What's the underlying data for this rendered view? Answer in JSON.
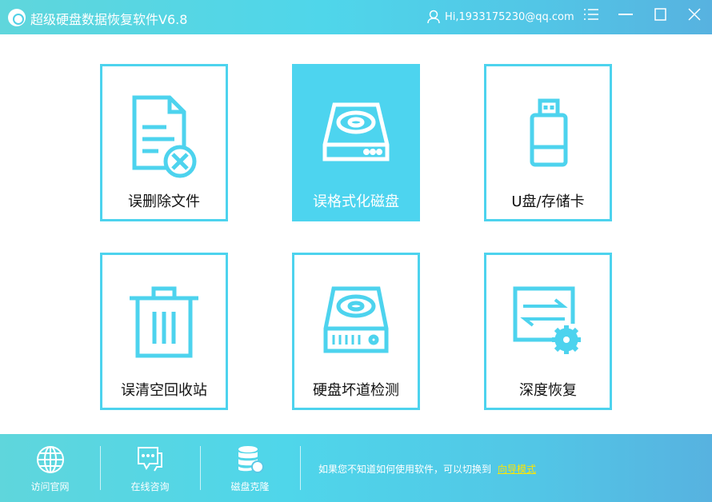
{
  "header": {
    "title": "超级硬盘数据恢复软件V6.8",
    "user": "Hi,1933175230@qq.com"
  },
  "tiles": [
    {
      "label": "误删除文件",
      "icon": "document-delete-icon"
    },
    {
      "label": "误格式化磁盘",
      "icon": "hard-drive-icon",
      "active": true
    },
    {
      "label": "U盘/存储卡",
      "icon": "usb-drive-icon"
    },
    {
      "label": "误清空回收站",
      "icon": "trash-icon"
    },
    {
      "label": "硬盘坏道检测",
      "icon": "disk-check-icon"
    },
    {
      "label": "深度恢复",
      "icon": "deep-recovery-icon"
    }
  ],
  "footer": {
    "items": [
      {
        "label": "访问官网"
      },
      {
        "label": "在线咨询"
      },
      {
        "label": "磁盘克隆"
      }
    ],
    "hint": "如果您不知道如何使用软件，可以切换到",
    "link": "向导模式"
  },
  "colors": {
    "accent": "#4dd3ee",
    "link": "#ffe600"
  }
}
